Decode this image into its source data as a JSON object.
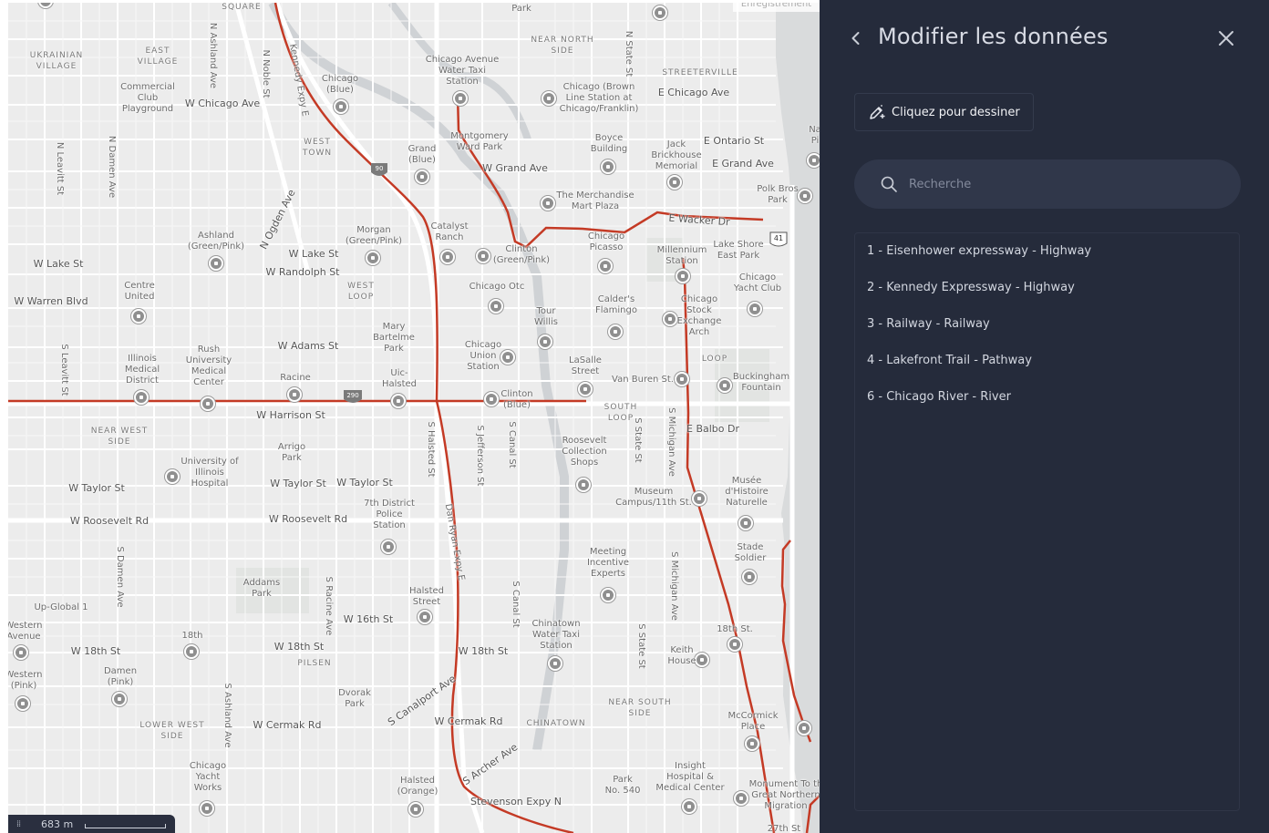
{
  "map": {
    "attribution": "Enregistrement",
    "scale_label": "683 m",
    "labels": {
      "square": "SQUARE",
      "ukrainian_village": "UKRAINIAN\nVILLAGE",
      "east_village": "EAST\nVILLAGE",
      "commercial_club": "Commercial\nClub\nPlayground",
      "w_chicago_ave": "W Chicago Ave",
      "n_ashland_ave": "N Ashland Ave",
      "n_noble_st": "N Noble St",
      "kennedy_expy": "Kennedy Expy E",
      "chicago_blue": "Chicago\n(Blue)",
      "west_town": "WEST\nTOWN",
      "n_leavitt_st": "N Leavitt St",
      "n_damen_ave": "N Damen Ave",
      "n_ogden_ave": "N Ogden Ave",
      "ashland_green_pink": "Ashland\n(Green/Pink)",
      "morgan": "Morgan\n(Green/Pink)",
      "grand_blue": "Grand\n(Blue)",
      "w_lake_st_left": "W Lake St",
      "w_lake_st": "W Lake St",
      "w_randolph_st": "W Randolph St",
      "w_warren_blvd": "W Warren Blvd",
      "centre_united": "Centre\nUnited",
      "west_loop": "WEST\nLOOP",
      "mary_bartelme": "Mary\nBartelme\nPark",
      "w_adams_st": "W Adams St",
      "illinois_medical": "Illinois\nMedical\nDistrict",
      "rush": "Rush\nUniversity\nMedical\nCenter",
      "racine": "Racine",
      "uic_halsted": "Uic-\nHalsted",
      "s_leavitt_st": "S Leavitt St",
      "w_harrison_st": "W Harrison St",
      "near_west_side": "NEAR WEST\nSIDE",
      "arrigo_park": "Arrigo\nPark",
      "uni_illinois_hospital": "University of\nIllinois\nHospital",
      "w_taylor_st_left": "W Taylor St",
      "w_taylor_st_mid": "W Taylor St",
      "w_taylor_st": "W Taylor St",
      "w_roosevelt_rd_left": "W Roosevelt Rd",
      "w_roosevelt_rd": "W Roosevelt Rd",
      "seventh_district": "7th District\nPolice\nStation",
      "s_halsted_st": "S Halsted St",
      "s_jefferson_st": "S Jefferson St",
      "s_canal_st": "S Canal St",
      "dan_ryan": "Dan Ryan Expy E",
      "s_damen_ave": "S Damen Ave",
      "addams_park": "Addams\nPark",
      "s_racine_ave": "S Racine Ave",
      "up_global": "Up-Global 1",
      "western_avenue": "Western\nAvenue",
      "eighteenth": "18th",
      "w_18th_st_left": "W 18th St",
      "w_18th_st_mid": "W 18th St",
      "w_18th_st": "W 18th St",
      "pilsen": "PILSEN",
      "halsted_street": "Halsted\nStreet",
      "w_16th_st": "W 16th St",
      "western_pink": "Western\n(Pink)",
      "damen_pink": "Damen\n(Pink)",
      "s_ashland_ave": "S Ashland Ave",
      "dvorak_park": "Dvorak\nPark",
      "s_canalport_ave": "S Canalport Ave",
      "w_cermak_rd_left": "W Cermak Rd",
      "w_cermak_rd": "W Cermak Rd",
      "lower_west_side": "LOWER WEST\nSIDE",
      "chicago_yacht_works": "Chicago\nYacht\nWorks",
      "halsted_orange": "Halsted\n(Orange)",
      "s_archer_ave": "S Archer Ave",
      "stevenson_expy": "Stevenson Expy N",
      "chinatown": "CHINATOWN",
      "chinatown_taxi": "Chinatown\nWater Taxi\nStation",
      "park_no_540": "Park\nNo. 540",
      "insight_hospital": "Insight\nHospital &\nMedical Center",
      "near_south_side": "NEAR SOUTH\nSIDE",
      "s_state_st_low": "S State St",
      "s_michigan_ave_low": "S Michigan Ave",
      "keith_house": "Keith\nHouse",
      "eighteenth_st": "18th St.",
      "mccormick_place": "McCormick\nPlace",
      "monument": "Monument To th\nGreat Northern\nMigration",
      "twenty_seventh": "27th St",
      "park_top": "Park",
      "near_north_side": "NEAR NORTH\nSIDE",
      "chicago_avenue_taxi": "Chicago Avenue\nWater Taxi\nStation",
      "chicago_brown": "Chicago (Brown\nLine Station at\nChicago/Franklin)",
      "n_state_st": "N State St",
      "streeterville": "STREETERVILLE",
      "e_chicago_ave": "E Chicago Ave",
      "boyce_building": "Boyce\nBuilding",
      "jack_brickhouse": "Jack\nBrickhouse\nMemorial",
      "e_ontario_st": "E Ontario St",
      "e_grand_ave": "E Grand Ave",
      "montgomery_ward": "Montgomery\nWard Park",
      "w_grand_ave": "W Grand Ave",
      "merchandise_mart": "The Merchandise\nMart Plaza",
      "e_wacker_dr": "E Wacker Dr",
      "polk_bros": "Polk Bros\nPark",
      "navy_pier": "Na\nPi",
      "catalyst_ranch": "Catalyst\nRanch",
      "clinton_green_pink": "Clinton\n(Green/Pink)",
      "chicago_picasso": "Chicago\nPicasso",
      "millennium_station": "Millennium\nStation",
      "lake_shore_park": "Lake Shore\nEast Park",
      "chicago_yacht_club": "Chicago\nYacht Club",
      "chicago_otc": "Chicago Otc",
      "tour_willis": "Tour\nWillis",
      "calders_flamingo": "Calder's\nFlamingo",
      "chicago_stock_exchange": "Chicago\nStock\nExchange\nArch",
      "chicago_union_station": "Chicago\nUnion\nStation",
      "lasalle_street": "LaSalle\nStreet",
      "van_buren_st": "Van Buren St.",
      "loop": "LOOP",
      "buckingham_fountain": "Buckingham\nFountain",
      "clinton_blue": "Clinton\n(Blue)",
      "south_loop": "SOUTH\nLOOP",
      "s_state_st": "S State St",
      "s_michigan_ave": "S Michigan Ave",
      "e_balbo_dr": "E Balbo Dr",
      "roosevelt_collection": "Roosevelt\nCollection\nShops",
      "museum_campus": "Museum\nCampus/11th St.",
      "musee": "Musée\nd'Histoire\nNaturelle",
      "stade_soldier": "Stade\nSoldier",
      "meeting_incentive": "Meeting\nIncentive\nExperts",
      "s_canal_st_low": "S Canal St",
      "i90": "90",
      "i290": "290",
      "us41": "41"
    }
  },
  "panel": {
    "title": "Modifier les données",
    "draw_button_label": "Cliquez pour dessiner",
    "search_placeholder": "Recherche",
    "items": [
      {
        "label": "1 - Eisenhower expressway - Highway"
      },
      {
        "label": "2 - Kennedy Expressway - Highway"
      },
      {
        "label": "3 - Railway - Railway"
      },
      {
        "label": "4 - Lakefront Trail - Pathway"
      },
      {
        "label": "6 - Chicago River - River"
      }
    ]
  },
  "colors": {
    "panel_bg": "#252b3b",
    "search_bg": "#30374a",
    "route_red": "#c43a25",
    "map_bg": "#ececec"
  },
  "icons": [
    "chevron-left-icon",
    "close-icon",
    "pencil-draw-icon",
    "search-icon",
    "drag-grip-icon",
    "transit-station-icon",
    "poi-icon"
  ]
}
